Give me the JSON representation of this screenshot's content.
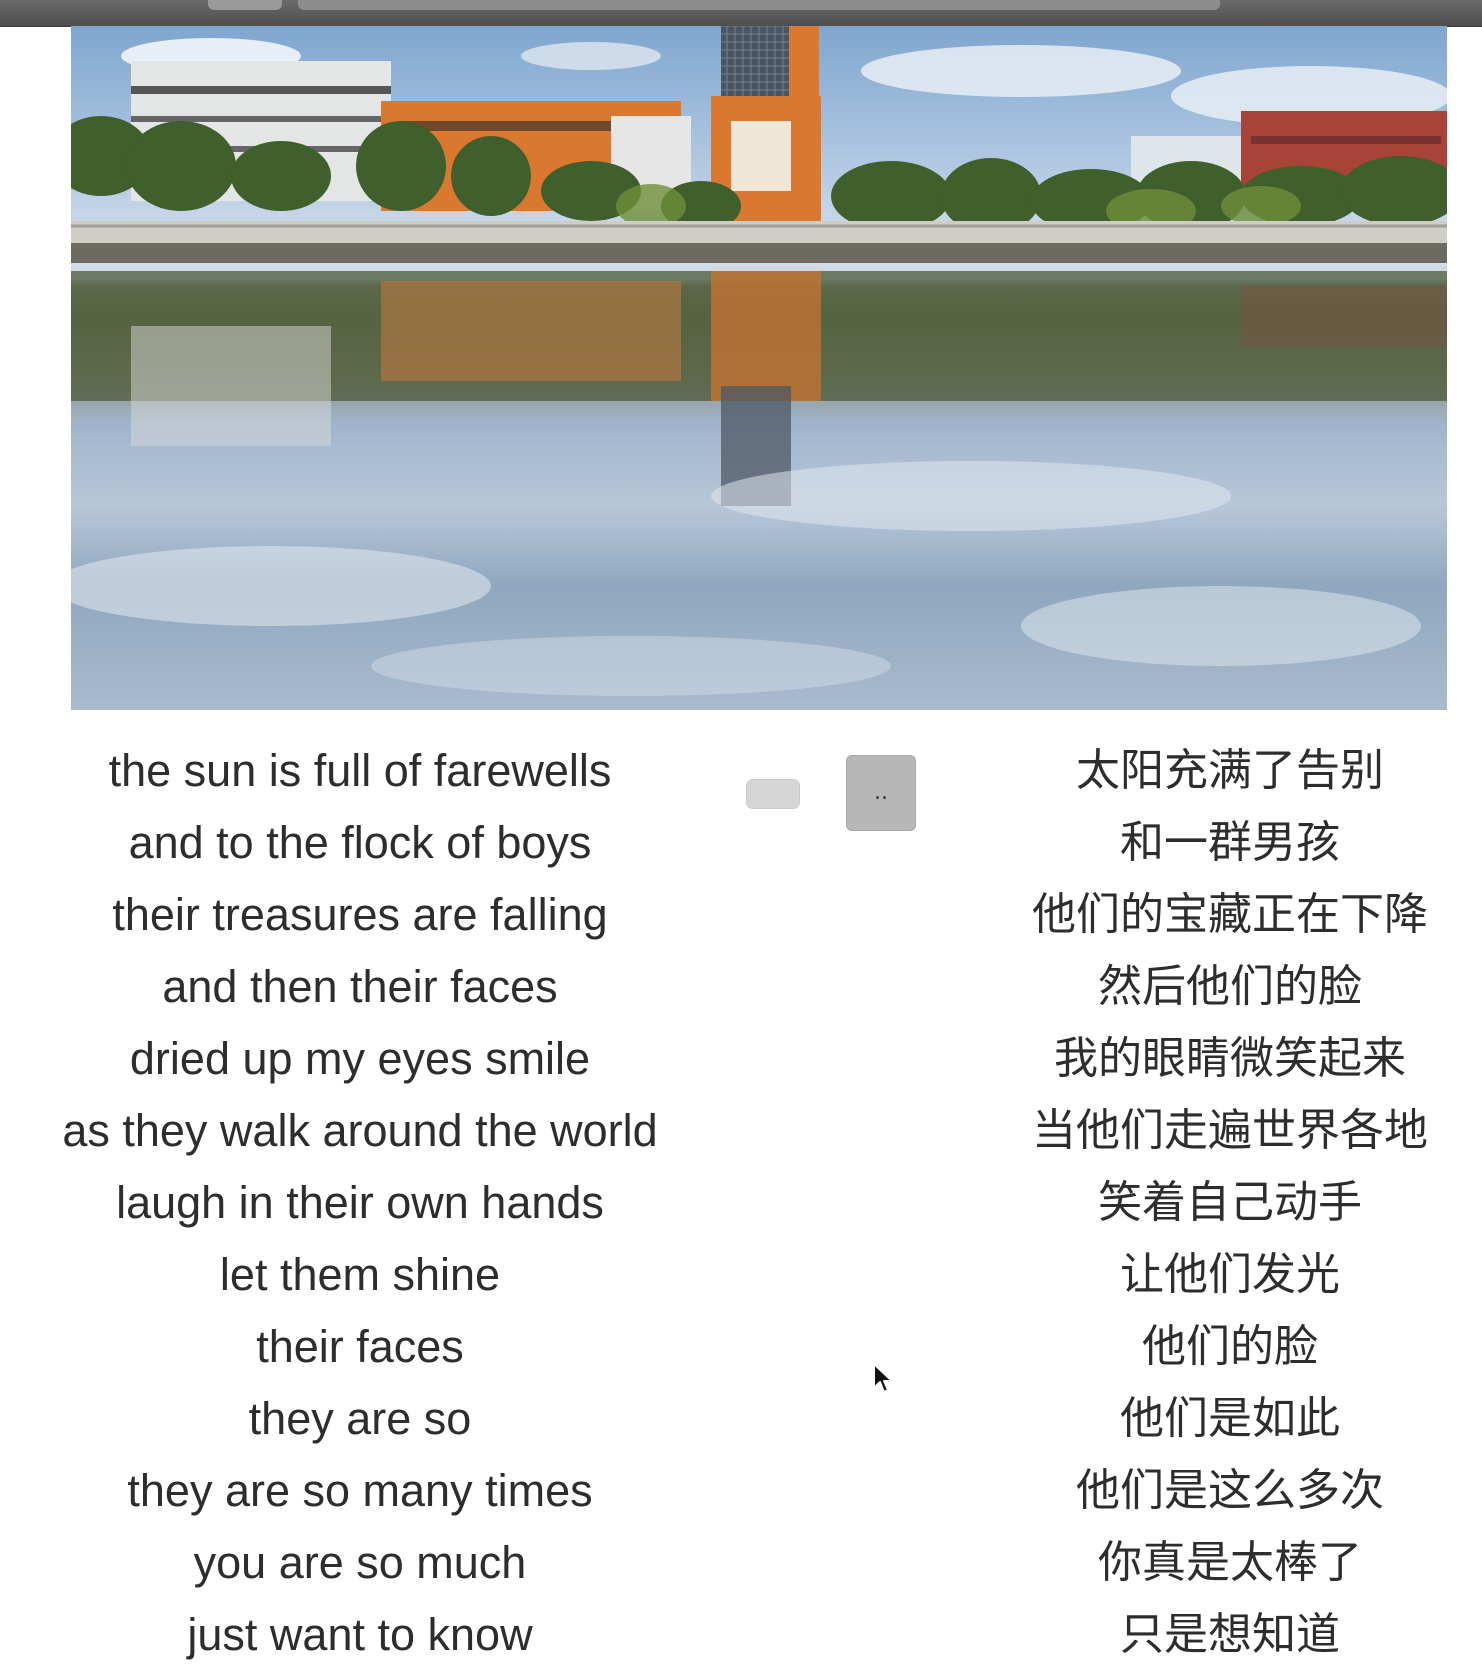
{
  "lyrics": {
    "english": [
      "the sun is full of farewells",
      "and to the flock of boys",
      "their treasures are falling",
      "and then their faces",
      "dried up my eyes smile",
      "as they walk around the world",
      "laugh in their own hands",
      "let them shine",
      "their faces",
      "they are so",
      "they are so many times",
      "you are so much",
      "just want to know"
    ],
    "chinese": [
      "太阳充满了告别",
      "和一群男孩",
      "他们的宝藏正在下降",
      "然后他们的脸",
      "我的眼睛微笑起来",
      "当他们走遍世界各地",
      "笑着自己动手",
      "让他们发光",
      "他们的脸",
      "他们是如此",
      "他们是这么多次",
      "你真是太棒了",
      "只是想知道"
    ]
  },
  "controls": {
    "more_label": ".."
  },
  "icons": {
    "cursor": "arrow-cursor-icon"
  }
}
